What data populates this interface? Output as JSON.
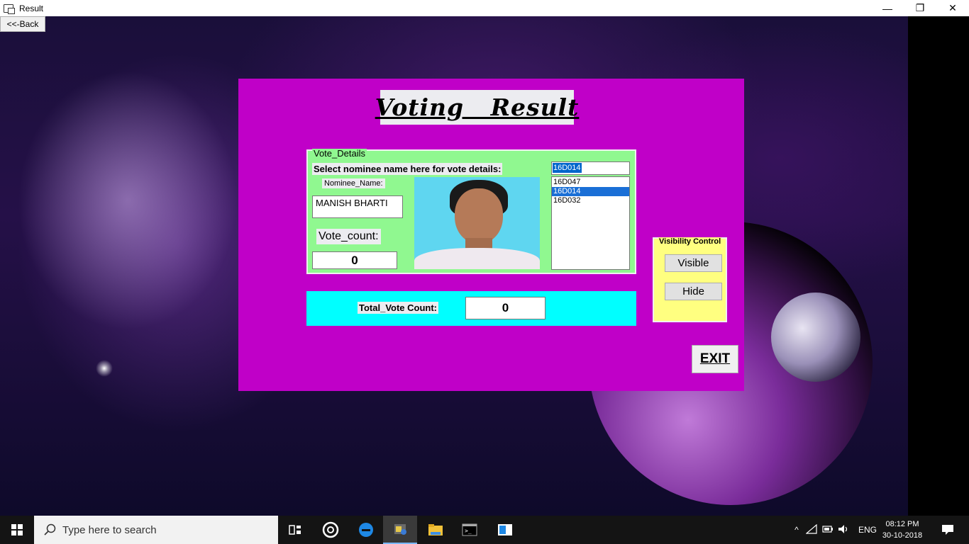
{
  "window": {
    "title": "Result",
    "minimize": "—",
    "maximize": "❐",
    "close": "✕"
  },
  "back_button": "<<-Back",
  "heading": "Voting   Result",
  "vote_details": {
    "legend": "Vote_Details",
    "select_label": "Select nominee name here for vote details:",
    "nominee_label": "Nominee_Name:",
    "nominee_value": "MANISH BHARTI",
    "vote_count_label": "Vote_count:",
    "vote_count_value": "0",
    "combo_value": "16D014",
    "list_items": [
      "16D047",
      "16D014",
      "16D032"
    ],
    "selected_item": "16D014"
  },
  "total": {
    "label": "Total_Vote Count:",
    "value": "0"
  },
  "visibility": {
    "legend": "Visibility Control",
    "visible_label": "Visible",
    "hide_label": "Hide"
  },
  "exit_label": "EXIT",
  "taskbar": {
    "search_placeholder": "Type here to search",
    "language": "ENG",
    "time": "08:12 PM",
    "date": "30-10-2018"
  }
}
